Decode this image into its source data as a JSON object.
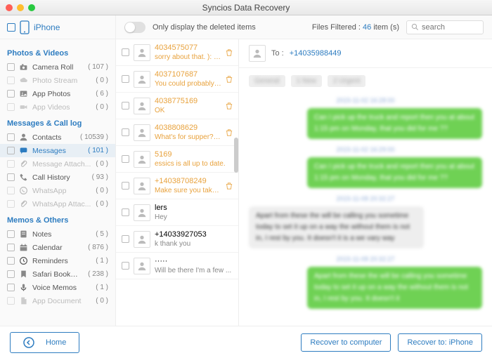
{
  "window": {
    "title": "Syncios Data Recovery"
  },
  "toolbar": {
    "device": "iPhone",
    "only_deleted_label": "Only display the deleted items",
    "filtered_prefix": "Files Filtered : ",
    "filtered_count": "46",
    "filtered_suffix": " item (s)",
    "search_placeholder": "search"
  },
  "sidebar": {
    "groups": [
      {
        "title": "Photos & Videos",
        "items": [
          {
            "label": "Camera Roll",
            "count": "( 107 )",
            "icon": "camera",
            "disabled": false
          },
          {
            "label": "Photo Stream",
            "count": "( 0 )",
            "icon": "cloud",
            "disabled": true
          },
          {
            "label": "App Photos",
            "count": "( 6 )",
            "icon": "photo",
            "disabled": false
          },
          {
            "label": "App Videos",
            "count": "( 0 )",
            "icon": "video",
            "disabled": true
          }
        ]
      },
      {
        "title": "Messages & Call log",
        "items": [
          {
            "label": "Contacts",
            "count": "( 10539 )",
            "icon": "contact",
            "disabled": false
          },
          {
            "label": "Messages",
            "count": "( 101 )",
            "icon": "message",
            "disabled": false,
            "selected": true
          },
          {
            "label": "Message Attach...",
            "count": "( 0 )",
            "icon": "attach",
            "disabled": true
          },
          {
            "label": "Call History",
            "count": "( 93 )",
            "icon": "phone",
            "disabled": false
          },
          {
            "label": "WhatsApp",
            "count": "( 0 )",
            "icon": "whatsapp",
            "disabled": true
          },
          {
            "label": "WhatsApp Attac...",
            "count": "( 0 )",
            "icon": "attach",
            "disabled": true
          }
        ]
      },
      {
        "title": "Memos & Others",
        "items": [
          {
            "label": "Notes",
            "count": "( 5 )",
            "icon": "note",
            "disabled": false
          },
          {
            "label": "Calendar",
            "count": "( 876 )",
            "icon": "calendar",
            "disabled": false
          },
          {
            "label": "Reminders",
            "count": "( 1 )",
            "icon": "reminder",
            "disabled": false
          },
          {
            "label": "Safari Bookmark",
            "count": "( 238 )",
            "icon": "bookmark",
            "disabled": false
          },
          {
            "label": "Voice Memos",
            "count": "( 1 )",
            "icon": "voice",
            "disabled": false
          },
          {
            "label": "App Document",
            "count": "( 0 )",
            "icon": "doc",
            "disabled": true
          }
        ]
      }
    ]
  },
  "conversations": [
    {
      "name": "4034575077",
      "preview": "sorry about that. ): okay,...",
      "deleted": true,
      "trash": true
    },
    {
      "name": "4037107687",
      "preview": "You could probably use ...",
      "deleted": true,
      "trash": true
    },
    {
      "name": "4038775169",
      "preview": "OK",
      "deleted": true,
      "trash": true
    },
    {
      "name": "4038808629",
      "preview": "What's for supper? I co...",
      "deleted": true,
      "trash": true
    },
    {
      "name": "5169",
      "preview": "essics is all up to date.",
      "deleted": true,
      "trash": false
    },
    {
      "name": "+14038708249",
      "preview": "Make sure you take pho...",
      "deleted": true,
      "trash": true
    },
    {
      "name": "lers",
      "preview": "Hey",
      "deleted": false,
      "trash": false
    },
    {
      "name": "+14033927053",
      "preview": "k thank you",
      "deleted": false,
      "trash": false
    },
    {
      "name": "·····",
      "preview": "Will be there I'm a few ...",
      "deleted": false,
      "trash": false
    }
  ],
  "detail": {
    "to_label": "To :",
    "to_number": "+14035988449",
    "chips": [
      "General",
      "1 New",
      "2 Urgent"
    ],
    "stream": [
      {
        "type": "ts",
        "text": "2015-11-02 16:28:00"
      },
      {
        "type": "out",
        "text": "Can I pick up the truck and report then you at about 1:15 pm on Monday, that you did for me ??",
        "lines": 2
      },
      {
        "type": "ts",
        "text": "2015-11-02 16:29:00"
      },
      {
        "type": "out",
        "text": "Can I pick up the truck and report then you at about 1:15 pm on Monday, that you did for me ??",
        "lines": 2
      },
      {
        "type": "ts",
        "text": "2015-11-08 20:32:27"
      },
      {
        "type": "in",
        "text": "Apart from these the will be calling you sometime today to set it up on a way the without them is not in, I rest by you. It doesn't it is a we vary way",
        "lines": 3
      },
      {
        "type": "ts",
        "text": "2015-11-08 20:32:27"
      },
      {
        "type": "out",
        "text": "Apart from these the will be calling you sometime today to set it up on a way the without them is not in, I rest by you. It doesn't it",
        "lines": 2
      }
    ]
  },
  "footer": {
    "home": "Home",
    "recover_computer": "Recover to computer",
    "recover_device": "Recover to: iPhone"
  }
}
